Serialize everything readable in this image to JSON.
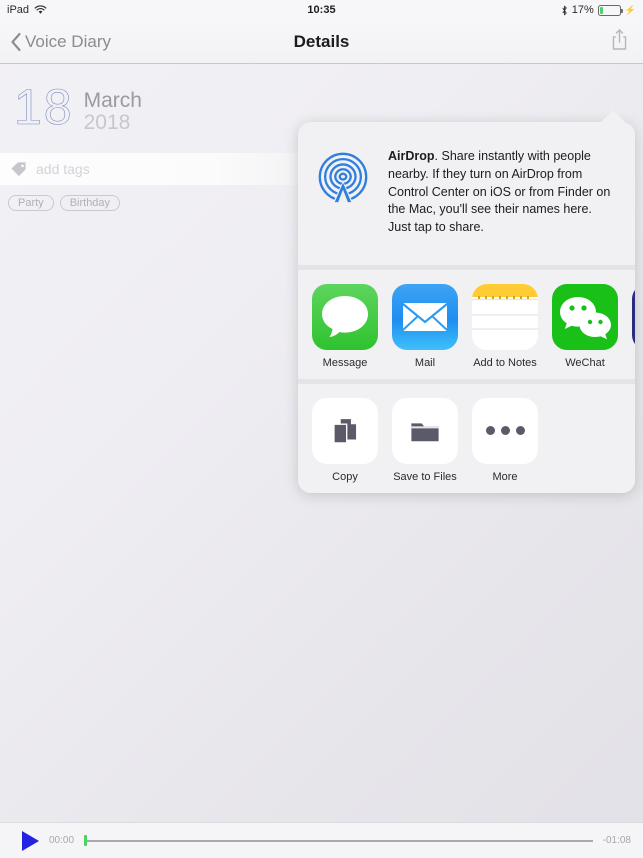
{
  "status_bar": {
    "device": "iPad",
    "wifi_icon": "wifi-icon",
    "time": "10:35",
    "bluetooth_icon": "bluetooth-icon",
    "battery_percent": "17%",
    "battery_level": 17,
    "charging_icon": "lightning-bolt-icon",
    "battery_color": "#4cd364"
  },
  "nav": {
    "back_label": "Voice Diary",
    "back_icon": "chevron-left-icon",
    "title": "Details",
    "share_icon": "share-icon"
  },
  "record": {
    "day": "18",
    "month": "March",
    "year": "2018",
    "tag_icon": "tag-icon",
    "tag_placeholder": "add tags",
    "tags": [
      "Party",
      "Birthday"
    ]
  },
  "share_sheet": {
    "airdrop": {
      "icon": "airdrop-icon",
      "title": "AirDrop",
      "description": ". Share instantly with people nearby. If they turn on AirDrop from Control Center on iOS or from Finder on the Mac, you'll see their names here. Just tap to share."
    },
    "apps": [
      {
        "label": "Message",
        "icon": "message-icon",
        "color": "#2ec32e"
      },
      {
        "label": "Mail",
        "icon": "mail-icon",
        "color": "#1d8ef0"
      },
      {
        "label": "Add to Notes",
        "icon": "notes-icon",
        "color": "#ffcc33"
      },
      {
        "label": "WeChat",
        "icon": "wechat-icon",
        "color": "#18c018"
      },
      {
        "label": "",
        "icon": "cutoff-app-icon",
        "color": "#2b2b80"
      }
    ],
    "actions": [
      {
        "label": "Copy",
        "icon": "copy-icon"
      },
      {
        "label": "Save to Files",
        "icon": "folder-icon"
      },
      {
        "label": "More",
        "icon": "more-ellipsis-icon"
      }
    ]
  },
  "player": {
    "play_icon": "play-icon",
    "current_time": "00:00",
    "remaining_time": "-01:08",
    "progress_percent": 0
  }
}
